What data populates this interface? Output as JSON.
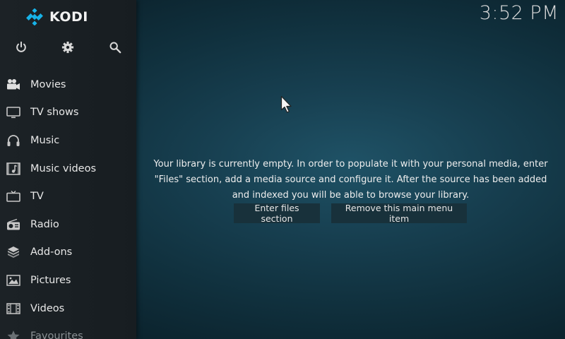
{
  "app": {
    "name": "KODI",
    "clock": "3:52 PM",
    "brand_color": "#17b2e7"
  },
  "top_buttons": [
    {
      "name": "power",
      "icon": "power-icon"
    },
    {
      "name": "settings",
      "icon": "gear-icon"
    },
    {
      "name": "search",
      "icon": "search-icon"
    }
  ],
  "menu": {
    "items": [
      {
        "label": "Movies",
        "icon": "movie-camera-icon"
      },
      {
        "label": "TV shows",
        "icon": "tv-icon"
      },
      {
        "label": "Music",
        "icon": "headphones-icon"
      },
      {
        "label": "Music videos",
        "icon": "music-video-icon"
      },
      {
        "label": "TV",
        "icon": "television-icon"
      },
      {
        "label": "Radio",
        "icon": "radio-icon"
      },
      {
        "label": "Add-ons",
        "icon": "addons-box-icon"
      },
      {
        "label": "Pictures",
        "icon": "picture-icon"
      },
      {
        "label": "Videos",
        "icon": "film-strip-icon"
      },
      {
        "label": "Favourites",
        "icon": "star-icon"
      }
    ]
  },
  "main": {
    "message": "Your library is currently empty. In order to populate it with your personal media, enter \"Files\" section, add a media source and configure it. After the source has been added and indexed you will be able to browse your library.",
    "buttons": {
      "enter_files": "Enter files section",
      "remove_item": "Remove this main menu item"
    }
  }
}
